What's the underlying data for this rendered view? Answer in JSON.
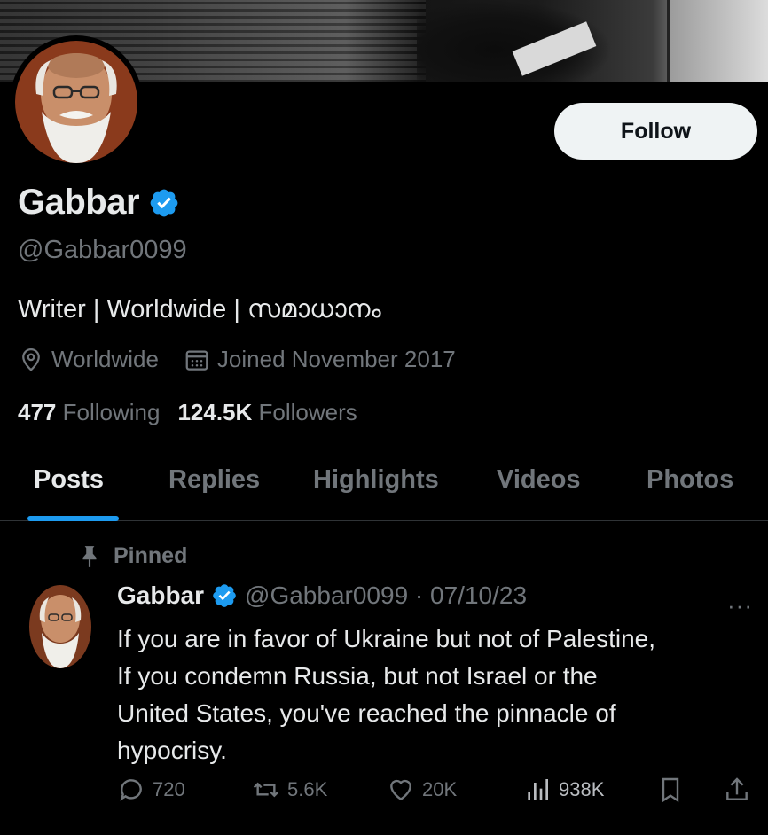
{
  "profile": {
    "name": "Gabbar",
    "handle": "@Gabbar0099",
    "bio": "Writer | Worldwide | സമാധാനം",
    "location": "Worldwide",
    "joined": "Joined November 2017",
    "following_count": "477",
    "following_label": "Following",
    "followers_count": "124.5K",
    "followers_label": "Followers"
  },
  "follow_button": {
    "label": "Follow"
  },
  "tabs": [
    {
      "label": "Posts",
      "active": true
    },
    {
      "label": "Replies"
    },
    {
      "label": "Highlights"
    },
    {
      "label": "Videos"
    },
    {
      "label": "Photos"
    }
  ],
  "post": {
    "pinned_label": "Pinned",
    "author_name": "Gabbar",
    "author_handle_date": "@Gabbar0099 · 07/10/23",
    "more": "···",
    "text_lines": [
      "If you are in favor of Ukraine but not of Palestine,",
      "If you condemn Russia, but not Israel or the",
      "United States, you've reached the pinnacle of",
      "hypocrisy."
    ],
    "replies": "720",
    "reposts": "5.6K",
    "likes": "20K",
    "views": "938K"
  },
  "colors": {
    "accent": "#1d9bf0",
    "background": "#000000",
    "text_primary": "#e7e9ea",
    "text_secondary": "#71767b",
    "button_bg": "#eff3f4"
  },
  "icons": [
    "verified-badge-icon",
    "location-pin-icon",
    "calendar-icon",
    "pin-icon",
    "more-icon",
    "reply-icon",
    "repost-icon",
    "like-icon",
    "views-icon",
    "bookmark-icon",
    "share-icon"
  ]
}
